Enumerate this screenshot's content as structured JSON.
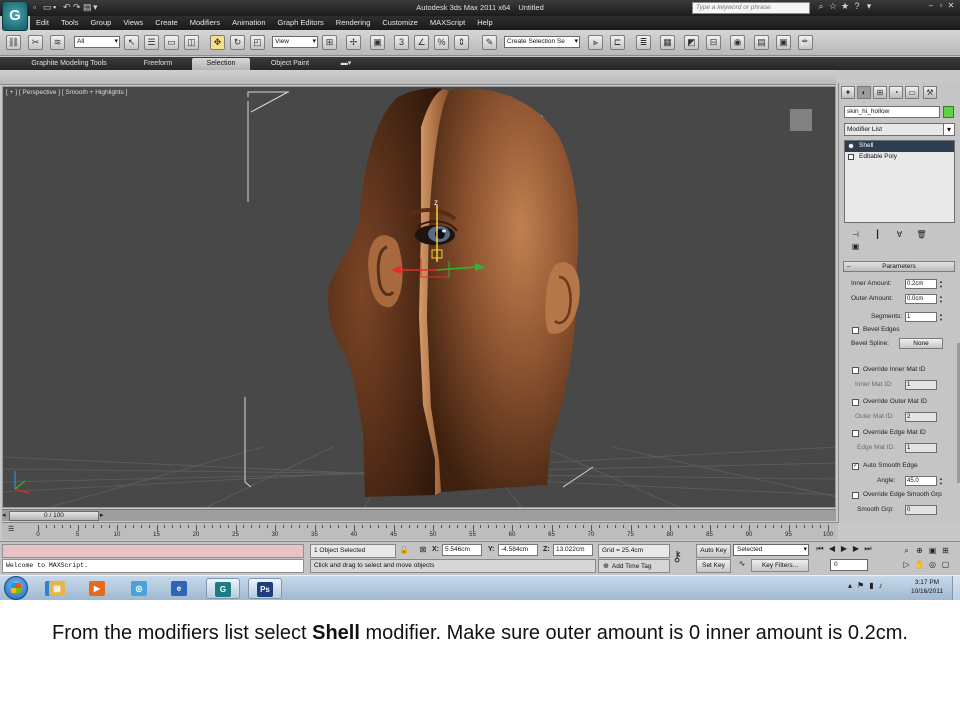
{
  "titlebar": {
    "app_name": "Autodesk 3ds Max  2011 x64",
    "doc_name": "Untitled",
    "search_placeholder": "Type a keyword or phrase"
  },
  "menu": [
    "Edit",
    "Tools",
    "Group",
    "Views",
    "Create",
    "Modifiers",
    "Animation",
    "Graph Editors",
    "Rendering",
    "Customize",
    "MAXScript",
    "Help"
  ],
  "toolbar": {
    "filter_value": "All",
    "refcoord_value": "View",
    "named_selection_value": "Create Selection Se"
  },
  "ribbon": {
    "tabs": [
      "Graphite Modeling Tools",
      "Freeform",
      "Selection",
      "Object Paint"
    ],
    "active_tab": "Selection"
  },
  "viewport": {
    "label": "[ + ] [ Perspective ] [ Smooth + Highlights ]",
    "gizmo_axis_z": "z"
  },
  "command_panel": {
    "object_name": "skin_hi_hollow",
    "object_color": "#5fd144",
    "modifier_list_label": "Modifier List",
    "stack": [
      {
        "label": "Shell",
        "selected": true
      },
      {
        "label": "Editable Poly",
        "selected": false
      }
    ],
    "parameters": {
      "title": "Parameters",
      "inner_amount_label": "Inner Amount:",
      "inner_amount": "0.2cm",
      "outer_amount_label": "Outer Amount:",
      "outer_amount": "0.0cm",
      "segments_label": "Segments:",
      "segments": "1",
      "bevel_edges_label": "Bevel Edges",
      "bevel_spline_label": "Bevel Spline:",
      "bevel_spline_value": "None",
      "override_inner_label": "Override Inner Mat ID",
      "inner_mat_label": "Inner Mat ID:",
      "inner_mat": "1",
      "override_outer_label": "Override Outer Mat ID",
      "outer_mat_label": "Outer Mat ID:",
      "outer_mat": "2",
      "override_edge_label": "Override Edge Mat ID",
      "edge_mat_label": "Edge Mat ID:",
      "edge_mat": "1",
      "auto_smooth_label": "Auto Smooth Edge",
      "angle_label": "Angle:",
      "angle": "45.0",
      "override_smooth_label": "Override Edge Smooth Grp",
      "smooth_grp_label": "Smooth Grp:",
      "smooth_grp": "0"
    }
  },
  "timeline": {
    "slider_label": "0 / 100",
    "ticks": [
      "0",
      "5",
      "10",
      "15",
      "20",
      "25",
      "30",
      "35",
      "40",
      "45",
      "50",
      "55",
      "60",
      "65",
      "70",
      "75",
      "80",
      "85",
      "90",
      "95",
      "100"
    ]
  },
  "status": {
    "maxscript_output": "Welcome to MAXScript.",
    "selection": "1 Object Selected",
    "prompt": "Click and drag to select and move objects",
    "x_label": "X:",
    "x": "5.546cm",
    "y_label": "Y:",
    "y": "-4.584cm",
    "z_label": "Z:",
    "z": "13.022cm",
    "grid": "Grid = 25.4cm",
    "add_time_tag": "Add Time Tag",
    "auto_key": "Auto Key",
    "set_key": "Set Key",
    "key_mode": "Selected",
    "key_filters": "Key Filters...",
    "current_frame": "0"
  },
  "taskbar": {
    "apps": [
      "ie-icon",
      "explorer-icon",
      "media-player-icon",
      "chrome-icon",
      "firefox-icon",
      "3dsmax-icon",
      "photoshop-icon"
    ],
    "time": "3:17 PM",
    "date": "10/16/2011"
  },
  "caption": {
    "before": "From the modifiers list select ",
    "bold": "Shell",
    "after": " modifier. Make sure outer amount is 0 inner amount is 0.2cm."
  }
}
